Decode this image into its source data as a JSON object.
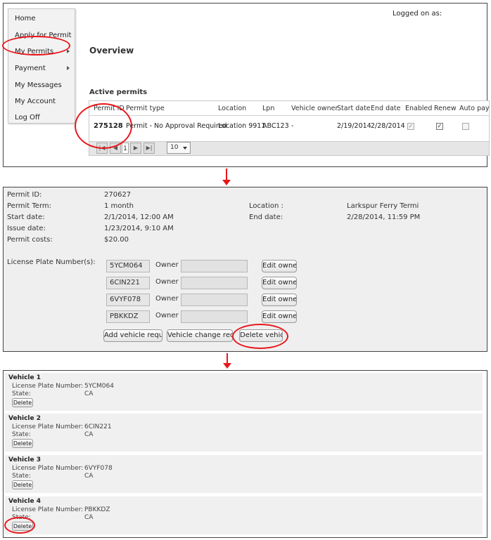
{
  "menu": {
    "items": [
      {
        "label": "Home"
      },
      {
        "label": "Apply for Permit"
      },
      {
        "label": "My Permits"
      },
      {
        "label": "Payment"
      },
      {
        "label": "My Messages"
      },
      {
        "label": "My Account"
      },
      {
        "label": "Log Off"
      }
    ]
  },
  "header": {
    "logged_on": "Logged on as:"
  },
  "overview": {
    "title": "Overview",
    "active_permits_title": "Active permits"
  },
  "permits_table": {
    "columns": [
      "Permit ID",
      "Permit type",
      "Location",
      "Lpn",
      "Vehicle owner",
      "Start date",
      "End date",
      "Enabled",
      "Renew",
      "Auto pay"
    ],
    "rows": [
      {
        "permit_id": "275128",
        "permit_type": "Permit - No Approval Required",
        "location": "Location 9911",
        "lpn": "ABC123",
        "vehicle_owner": "-",
        "start_date": "2/19/2014",
        "end_date": "2/28/2014",
        "enabled": true,
        "renew": true,
        "auto_pay": false
      }
    ],
    "pager": {
      "current_page": "1",
      "page_size": "10"
    }
  },
  "permit_details": {
    "permit_id_label": "Permit ID:",
    "permit_id": "270627",
    "permit_term_label": "Permit Term:",
    "permit_term": "1 month",
    "start_date_label": "Start date:",
    "start_date": "2/1/2014, 12:00 AM",
    "issue_date_label": "Issue date:",
    "issue_date": "1/23/2014, 9:10 AM",
    "permit_costs_label": "Permit costs:",
    "permit_costs": "$20.00",
    "location_label": "Location :",
    "location": "Larkspur Ferry Termi",
    "end_date_label": "End date:",
    "end_date": "2/28/2014, 11:59 PM",
    "plates_label": "License Plate Number(s):",
    "owner_label": "Owner",
    "plates": [
      "5YCM064",
      "6CIN221",
      "6VYF078",
      "PBKKDZ"
    ],
    "edit_owner_label": "Edit owner",
    "add_vehicle_label": "Add vehicle request",
    "vehicle_change_label": "Vehicle change reques",
    "delete_vehicle_label": "Delete vehicle"
  },
  "vehicles": {
    "plate_label": "License Plate Number:",
    "state_label": "State:",
    "delete_label": "Delete",
    "items": [
      {
        "title": "Vehicle 1",
        "plate": "5YCM064",
        "state": "CA"
      },
      {
        "title": "Vehicle 2",
        "plate": "6CIN221",
        "state": "CA"
      },
      {
        "title": "Vehicle 3",
        "plate": "6VYF078",
        "state": "CA"
      },
      {
        "title": "Vehicle 4",
        "plate": "PBKKDZ",
        "state": "CA"
      }
    ]
  },
  "colors": {
    "highlight_ring": "#e8161b"
  }
}
